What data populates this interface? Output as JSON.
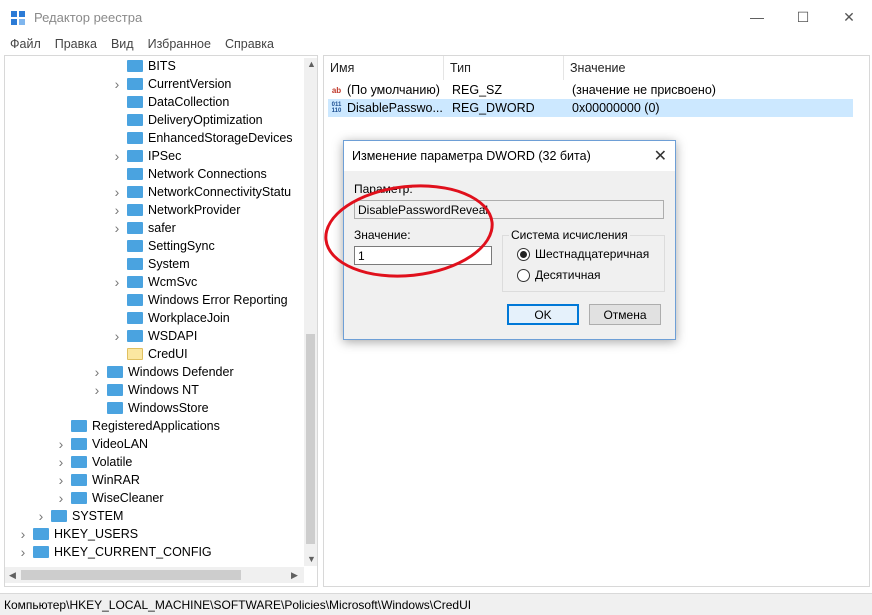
{
  "window": {
    "title": "Редактор реестра",
    "minimize_glyph": "—",
    "maximize_glyph": "☐",
    "close_glyph": "✕"
  },
  "menu": [
    "Файл",
    "Правка",
    "Вид",
    "Избранное",
    "Справка"
  ],
  "tree": [
    {
      "label": "BITS",
      "level": 5,
      "expander": false,
      "icon": "folder-icon"
    },
    {
      "label": "CurrentVersion",
      "level": 5,
      "expander": true,
      "icon": "folder-icon"
    },
    {
      "label": "DataCollection",
      "level": 5,
      "expander": false,
      "icon": "folder-icon"
    },
    {
      "label": "DeliveryOptimization",
      "level": 5,
      "expander": false,
      "icon": "folder-icon"
    },
    {
      "label": "EnhancedStorageDevices",
      "level": 5,
      "expander": false,
      "icon": "folder-icon"
    },
    {
      "label": "IPSec",
      "level": 5,
      "expander": true,
      "icon": "folder-icon"
    },
    {
      "label": "Network Connections",
      "level": 5,
      "expander": false,
      "icon": "folder-icon"
    },
    {
      "label": "NetworkConnectivityStatu",
      "level": 5,
      "expander": true,
      "icon": "folder-icon"
    },
    {
      "label": "NetworkProvider",
      "level": 5,
      "expander": true,
      "icon": "folder-icon"
    },
    {
      "label": "safer",
      "level": 5,
      "expander": true,
      "icon": "folder-icon"
    },
    {
      "label": "SettingSync",
      "level": 5,
      "expander": false,
      "icon": "folder-icon"
    },
    {
      "label": "System",
      "level": 5,
      "expander": false,
      "icon": "folder-icon"
    },
    {
      "label": "WcmSvc",
      "level": 5,
      "expander": true,
      "icon": "folder-icon"
    },
    {
      "label": "Windows Error Reporting",
      "level": 5,
      "expander": false,
      "icon": "folder-icon"
    },
    {
      "label": "WorkplaceJoin",
      "level": 5,
      "expander": false,
      "icon": "folder-icon"
    },
    {
      "label": "WSDAPI",
      "level": 5,
      "expander": true,
      "icon": "folder-icon"
    },
    {
      "label": "CredUI",
      "level": 5,
      "expander": false,
      "icon": "open-folder-icon",
      "selected": true
    },
    {
      "label": "Windows Defender",
      "level": 4,
      "expander": true,
      "icon": "folder-icon"
    },
    {
      "label": "Windows NT",
      "level": 4,
      "expander": true,
      "icon": "folder-icon"
    },
    {
      "label": "WindowsStore",
      "level": 4,
      "expander": false,
      "icon": "folder-icon"
    },
    {
      "label": "RegisteredApplications",
      "level": 3,
      "expander": false,
      "icon": "folder-icon"
    },
    {
      "label": "VideoLAN",
      "level": 3,
      "expander": true,
      "icon": "folder-icon"
    },
    {
      "label": "Volatile",
      "level": 3,
      "expander": true,
      "icon": "folder-icon"
    },
    {
      "label": "WinRAR",
      "level": 3,
      "expander": true,
      "icon": "folder-icon"
    },
    {
      "label": "WiseCleaner",
      "level": 3,
      "expander": true,
      "icon": "folder-icon"
    },
    {
      "label": "SYSTEM",
      "level": 2,
      "expander": true,
      "icon": "folder-icon"
    },
    {
      "label": "HKEY_USERS",
      "level": 1,
      "expander": true,
      "icon": "folder-icon"
    },
    {
      "label": "HKEY_CURRENT_CONFIG",
      "level": 1,
      "expander": true,
      "icon": "folder-icon"
    }
  ],
  "list": {
    "columns": [
      "Имя",
      "Тип",
      "Значение"
    ],
    "rows": [
      {
        "name": "(По умолчанию)",
        "type": "REG_SZ",
        "value": "(значение не присвоено)",
        "icon": "string-value-icon",
        "icon_text": "ab",
        "selected": false
      },
      {
        "name": "DisablePasswo...",
        "type": "REG_DWORD",
        "value": "0x00000000 (0)",
        "icon": "binary-value-icon",
        "icon_text": "011\n110",
        "selected": true
      }
    ]
  },
  "dialog": {
    "title": "Изменение параметра DWORD (32 бита)",
    "close_glyph": "✕",
    "param_label": "Параметр:",
    "param_value": "DisablePasswordReveal",
    "value_label": "Значение:",
    "value_input": "1",
    "base_label": "Система исчисления",
    "radio_hex": "Шестнадцатеричная",
    "radio_dec": "Десятичная",
    "selected_base": "hex",
    "ok": "OK",
    "cancel": "Отмена"
  },
  "status": "Компьютер\\HKEY_LOCAL_MACHINE\\SOFTWARE\\Policies\\Microsoft\\Windows\\CredUI",
  "colors": {
    "highlight_circle": "#e0101c",
    "selection": "#cce8ff",
    "accent": "#0078d7"
  }
}
